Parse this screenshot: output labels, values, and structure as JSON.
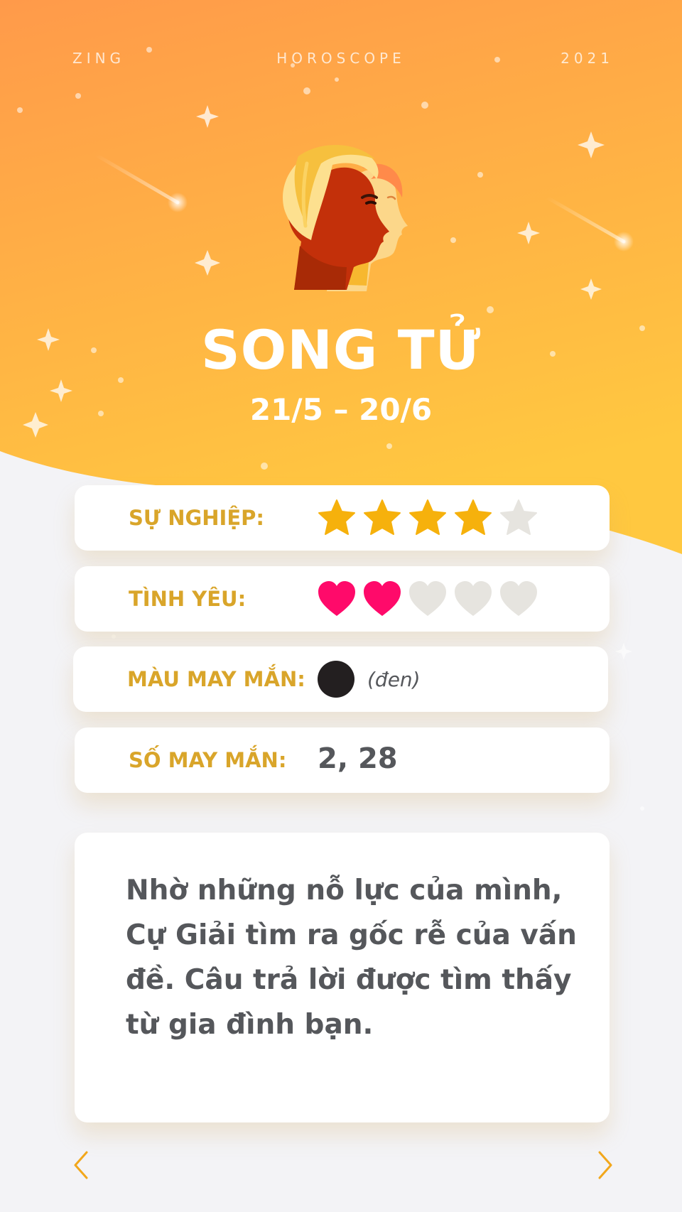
{
  "header": {
    "brand": "ZING",
    "section": "HOROSCOPE",
    "year": "2021"
  },
  "sign": {
    "name": "SONG TỬ",
    "dates": "21/5 – 20/6",
    "avatar_icon": "gemini-twins-faces-icon"
  },
  "ratings": [
    {
      "label": "SỰ NGHIỆP:",
      "kind": "star",
      "score": 4,
      "max": 5,
      "active_color": "#f6b10c",
      "inactive_color": "#e6e4df"
    },
    {
      "label": "TÌNH YÊU:",
      "kind": "heart",
      "score": 2,
      "max": 5,
      "active_color": "#ff0a6a",
      "inactive_color": "#e6e4df"
    }
  ],
  "lucky_color": {
    "label": "MÀU MAY MẮN:",
    "name": "(đen)",
    "swatch": "#231f20"
  },
  "lucky_number": {
    "label": "SỐ MAY MẮN:",
    "value": "2, 28"
  },
  "message": "Nhờ những nỗ lực của mình, Cự Giải tìm ra gốc rễ của vấn đề. Câu trả lời được tìm thấy từ gia đình bạn.",
  "navigation": {
    "prev_icon": "chevron-left-icon",
    "next_icon": "chevron-right-icon"
  },
  "colors": {
    "header_gradient_top": "#ff9a4a",
    "header_gradient_bottom": "#ffc840",
    "label": "#d9a52a",
    "body_text": "#55575b",
    "background": "#f3f3f6"
  }
}
